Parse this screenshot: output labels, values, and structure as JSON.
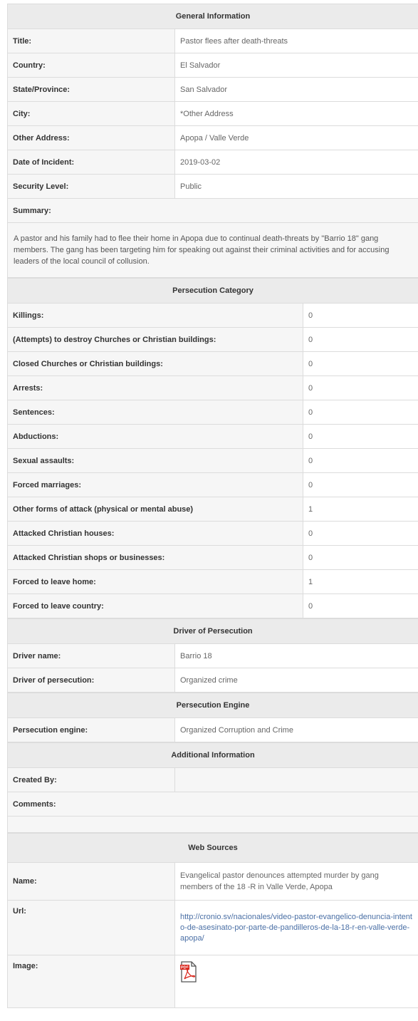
{
  "general": {
    "header": "General Information",
    "fields": [
      {
        "label": "Title:",
        "value": "Pastor flees after death-threats"
      },
      {
        "label": "Country:",
        "value": "El Salvador"
      },
      {
        "label": "State/Province:",
        "value": "San Salvador"
      },
      {
        "label": "City:",
        "value": "*Other Address"
      },
      {
        "label": "Other Address:",
        "value": "Apopa / Valle Verde"
      },
      {
        "label": "Date of Incident:",
        "value": "2019-03-02"
      },
      {
        "label": "Security Level:",
        "value": "Public"
      }
    ],
    "summary_label": "Summary:",
    "summary_text": "A pastor and his family had to flee their home in Apopa due to continual death-threats by \"Barrio 18\" gang members. The gang has been targeting him for speaking out against their criminal activities and for accusing leaders of the local council of collusion."
  },
  "persecution_category": {
    "header": "Persecution Category",
    "items": [
      {
        "label": "Killings:",
        "value": "0"
      },
      {
        "label": "(Attempts) to destroy Churches or Christian buildings:",
        "value": "0"
      },
      {
        "label": "Closed Churches or Christian buildings:",
        "value": "0"
      },
      {
        "label": "Arrests:",
        "value": "0"
      },
      {
        "label": "Sentences:",
        "value": "0"
      },
      {
        "label": "Abductions:",
        "value": "0"
      },
      {
        "label": "Sexual assaults:",
        "value": "0"
      },
      {
        "label": "Forced marriages:",
        "value": "0"
      },
      {
        "label": "Other forms of attack (physical or mental abuse)",
        "value": "1"
      },
      {
        "label": "Attacked Christian houses:",
        "value": "0"
      },
      {
        "label": "Attacked Christian shops or businesses:",
        "value": "0"
      },
      {
        "label": "Forced to leave home:",
        "value": "1"
      },
      {
        "label": "Forced to leave country:",
        "value": "0"
      }
    ]
  },
  "driver": {
    "header": "Driver of Persecution",
    "fields": [
      {
        "label": "Driver name:",
        "value": "Barrio 18"
      },
      {
        "label": "Driver of persecution:",
        "value": "Organized crime"
      }
    ]
  },
  "engine": {
    "header": "Persecution Engine",
    "label": "Persecution engine:",
    "value": "Organized Corruption and Crime"
  },
  "additional": {
    "header": "Additional Information",
    "created_by_label": "Created By:",
    "created_by_value": "",
    "comments_label": "Comments:"
  },
  "web_sources": {
    "header": "Web Sources",
    "name_label": "Name:",
    "name_value": "Evangelical pastor denounces attempted murder by gang members of the 18 -R in Valle Verde, Apopa",
    "url_label": "Url:",
    "url_value": "http://cronio.sv/nacionales/video-pastor-evangelico-denuncia-intento-de-asesinato-por-parte-de-pandilleros-de-la-18-r-en-valle-verde-apopa/",
    "image_label": "Image:",
    "image_icon": "pdf-icon",
    "pdf_badge": "PDF"
  },
  "colors": {
    "header_bg": "#ebebeb",
    "label_bg": "#f6f6f6",
    "border": "#dcdcdc",
    "link": "#4a6fa5",
    "pdf_red": "#d9261c"
  }
}
